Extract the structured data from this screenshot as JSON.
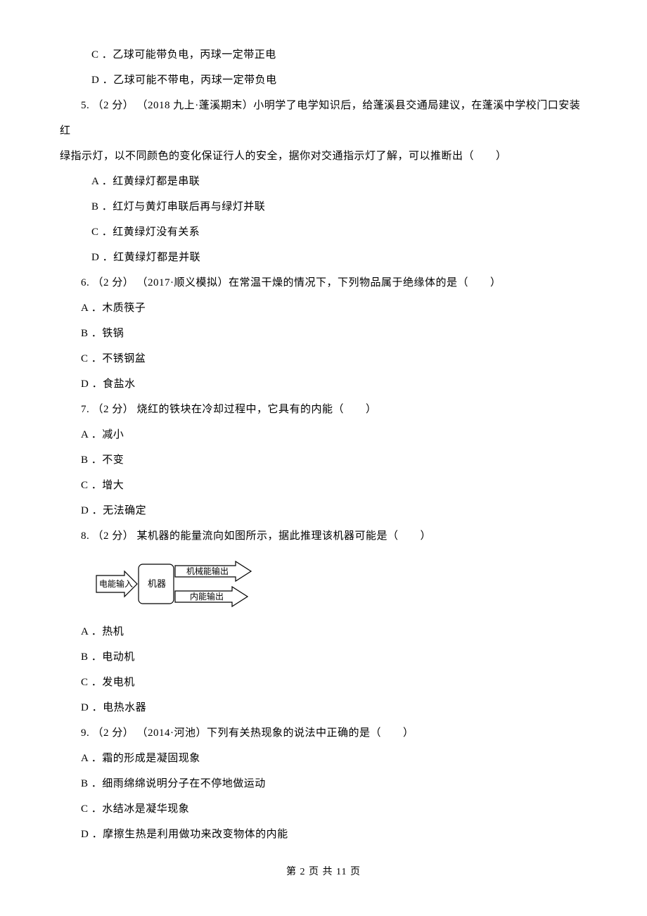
{
  "q4_option_c": "C ．乙球可能带负电，丙球一定带正电",
  "q4_option_d": "D ．乙球可能不带电，丙球一定带负电",
  "q5_stem": "5.  （2 分） （2018 九上·蓬溪期末）小明学了电学知识后，给蓬溪县交通局建议，在蓬溪中学校门口安装红",
  "q5_stem_line2": "绿指示灯，以不同颜色的变化保证行人的安全，据你对交通指示灯了解，可以推断出（　　）",
  "q5_option_a": "A ．红黄绿灯都是串联",
  "q5_option_b": "B ．红灯与黄灯串联后再与绿灯并联",
  "q5_option_c": "C ．红黄绿灯没有关系",
  "q5_option_d": "D ．红黄绿灯都是并联",
  "q6_stem": "6.  （2 分） （2017·顺义模拟）在常温干燥的情况下，下列物品属于绝缘体的是（　　）",
  "q6_option_a": "A ．木质筷子",
  "q6_option_b": "B ．铁锅",
  "q6_option_c": "C ．不锈钢盆",
  "q6_option_d": "D ．食盐水",
  "q7_stem": "7.  （2 分） 烧红的铁块在冷却过程中，它具有的内能（　　）",
  "q7_option_a": "A ．减小",
  "q7_option_b": "B ．不变",
  "q7_option_c": "C ．增大",
  "q7_option_d": "D ．无法确定",
  "q8_stem": "8.  （2 分） 某机器的能量流向如图所示，据此推理该机器可能是（　　）",
  "q8_option_a": "A ．热机",
  "q8_option_b": "B ．电动机",
  "q8_option_c": "C ．发电机",
  "q8_option_d": "D ．电热水器",
  "q9_stem": "9.  （2 分） （2014·河池）下列有关热现象的说法中正确的是（　　）",
  "q9_option_a": "A ．霜的形成是凝固现象",
  "q9_option_b": "B ．细雨绵绵说明分子在不停地做运动",
  "q9_option_c": "C ．水结冰是凝华现象",
  "q9_option_d": "D ．摩擦生热是利用做功来改变物体的内能",
  "diagram": {
    "input_label": "电能输入",
    "machine_label": "机器",
    "output_top": "机械能输出",
    "output_bottom": "内能输出"
  },
  "footer": "第 2 页 共 11 页"
}
